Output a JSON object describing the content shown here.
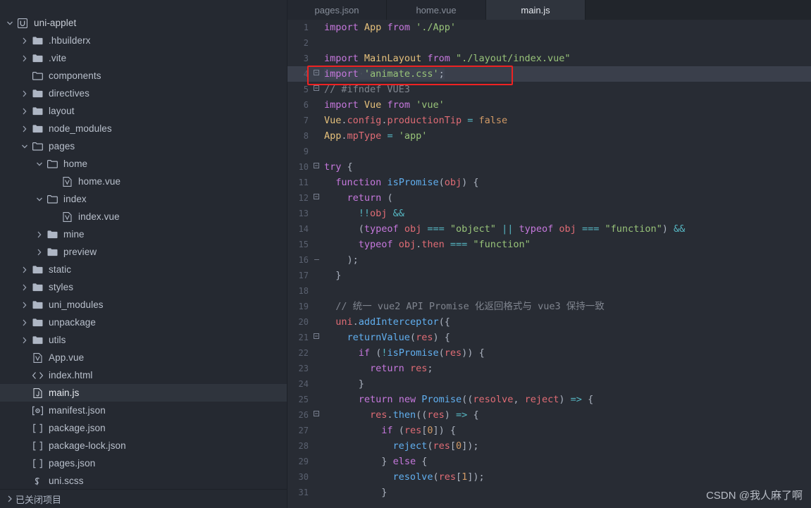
{
  "sidebar": {
    "tree": [
      {
        "label": "uni-applet",
        "depth": 0,
        "twisty": "down",
        "icon": "uni-logo-icon",
        "selected": false
      },
      {
        "label": ".hbuilderx",
        "depth": 1,
        "twisty": "right",
        "icon": "folder-icon",
        "selected": false
      },
      {
        "label": ".vite",
        "depth": 1,
        "twisty": "right",
        "icon": "folder-icon",
        "selected": false
      },
      {
        "label": "components",
        "depth": 1,
        "twisty": "none",
        "icon": "folder-open-icon",
        "selected": false
      },
      {
        "label": "directives",
        "depth": 1,
        "twisty": "right",
        "icon": "folder-icon",
        "selected": false
      },
      {
        "label": "layout",
        "depth": 1,
        "twisty": "right",
        "icon": "folder-icon",
        "selected": false
      },
      {
        "label": "node_modules",
        "depth": 1,
        "twisty": "right",
        "icon": "folder-icon",
        "selected": false
      },
      {
        "label": "pages",
        "depth": 1,
        "twisty": "down",
        "icon": "folder-open-icon",
        "selected": false
      },
      {
        "label": "home",
        "depth": 2,
        "twisty": "down",
        "icon": "folder-open-icon",
        "selected": false
      },
      {
        "label": "home.vue",
        "depth": 3,
        "twisty": "none",
        "icon": "vue-file-icon",
        "selected": false
      },
      {
        "label": "index",
        "depth": 2,
        "twisty": "down",
        "icon": "folder-open-icon",
        "selected": false
      },
      {
        "label": "index.vue",
        "depth": 3,
        "twisty": "none",
        "icon": "vue-file-icon",
        "selected": false
      },
      {
        "label": "mine",
        "depth": 2,
        "twisty": "right",
        "icon": "folder-icon",
        "selected": false
      },
      {
        "label": "preview",
        "depth": 2,
        "twisty": "right",
        "icon": "folder-icon",
        "selected": false
      },
      {
        "label": "static",
        "depth": 1,
        "twisty": "right",
        "icon": "folder-icon",
        "selected": false
      },
      {
        "label": "styles",
        "depth": 1,
        "twisty": "right",
        "icon": "folder-icon",
        "selected": false
      },
      {
        "label": "uni_modules",
        "depth": 1,
        "twisty": "right",
        "icon": "folder-icon",
        "selected": false
      },
      {
        "label": "unpackage",
        "depth": 1,
        "twisty": "right",
        "icon": "folder-icon",
        "selected": false
      },
      {
        "label": "utils",
        "depth": 1,
        "twisty": "right",
        "icon": "folder-icon",
        "selected": false
      },
      {
        "label": "App.vue",
        "depth": 1,
        "twisty": "none",
        "icon": "vue-file-icon",
        "selected": false
      },
      {
        "label": "index.html",
        "depth": 1,
        "twisty": "none",
        "icon": "html-file-icon",
        "selected": false
      },
      {
        "label": "main.js",
        "depth": 1,
        "twisty": "none",
        "icon": "js-file-icon",
        "selected": true
      },
      {
        "label": "manifest.json",
        "depth": 1,
        "twisty": "none",
        "icon": "manifest-file-icon",
        "selected": false
      },
      {
        "label": "package.json",
        "depth": 1,
        "twisty": "none",
        "icon": "json-file-icon",
        "selected": false
      },
      {
        "label": "package-lock.json",
        "depth": 1,
        "twisty": "none",
        "icon": "json-file-icon",
        "selected": false
      },
      {
        "label": "pages.json",
        "depth": 1,
        "twisty": "none",
        "icon": "json-file-icon",
        "selected": false
      },
      {
        "label": "uni.scss",
        "depth": 1,
        "twisty": "none",
        "icon": "scss-file-icon",
        "selected": false
      }
    ],
    "closed_projects": {
      "label": "已关闭项目",
      "twisty": "right"
    }
  },
  "tabs": [
    {
      "label": "pages.json",
      "active": false
    },
    {
      "label": "home.vue",
      "active": false
    },
    {
      "label": "main.js",
      "active": true
    }
  ],
  "editor": {
    "file": "main.js",
    "lines": [
      {
        "n": 1,
        "fold": "",
        "text": "import App from './App'"
      },
      {
        "n": 2,
        "fold": "",
        "text": ""
      },
      {
        "n": 3,
        "fold": "",
        "text": "import MainLayout from \"./layout/index.vue\""
      },
      {
        "n": 4,
        "fold": "box",
        "text": "import 'animate.css';"
      },
      {
        "n": 5,
        "fold": "box",
        "text": "// #ifndef VUE3"
      },
      {
        "n": 6,
        "fold": "",
        "text": "import Vue from 'vue'"
      },
      {
        "n": 7,
        "fold": "",
        "text": "Vue.config.productionTip = false"
      },
      {
        "n": 8,
        "fold": "",
        "text": "App.mpType = 'app'"
      },
      {
        "n": 9,
        "fold": "",
        "text": ""
      },
      {
        "n": 10,
        "fold": "box",
        "text": "try {"
      },
      {
        "n": 11,
        "fold": "",
        "text": "  function isPromise(obj) {"
      },
      {
        "n": 12,
        "fold": "box",
        "text": "    return ("
      },
      {
        "n": 13,
        "fold": "",
        "text": "      !!obj &&"
      },
      {
        "n": 14,
        "fold": "",
        "text": "      (typeof obj === \"object\" || typeof obj === \"function\") &&"
      },
      {
        "n": 15,
        "fold": "",
        "text": "      typeof obj.then === \"function\""
      },
      {
        "n": 16,
        "fold": "dash",
        "text": "    );"
      },
      {
        "n": 17,
        "fold": "",
        "text": "  }"
      },
      {
        "n": 18,
        "fold": "",
        "text": ""
      },
      {
        "n": 19,
        "fold": "",
        "text": "  // 统一 vue2 API Promise 化返回格式与 vue3 保持一致"
      },
      {
        "n": 20,
        "fold": "",
        "text": "  uni.addInterceptor({"
      },
      {
        "n": 21,
        "fold": "box",
        "text": "    returnValue(res) {"
      },
      {
        "n": 22,
        "fold": "",
        "text": "      if (!isPromise(res)) {"
      },
      {
        "n": 23,
        "fold": "",
        "text": "        return res;"
      },
      {
        "n": 24,
        "fold": "",
        "text": "      }"
      },
      {
        "n": 25,
        "fold": "",
        "text": "      return new Promise((resolve, reject) => {"
      },
      {
        "n": 26,
        "fold": "box",
        "text": "        res.then((res) => {"
      },
      {
        "n": 27,
        "fold": "",
        "text": "          if (res[0]) {"
      },
      {
        "n": 28,
        "fold": "",
        "text": "            reject(res[0]);"
      },
      {
        "n": 29,
        "fold": "",
        "text": "          } else {"
      },
      {
        "n": 30,
        "fold": "",
        "text": "            resolve(res[1]);"
      },
      {
        "n": 31,
        "fold": "",
        "text": "          }"
      }
    ],
    "highlight": {
      "line": 4,
      "annotation_color": "#ee2222"
    }
  },
  "watermark": {
    "text": "CSDN @我人麻了啊"
  },
  "colors": {
    "sidebar_bg": "#252931",
    "editor_bg": "#282c34",
    "tab_active_bg": "#2f343d",
    "accent_red": "#ee2222"
  }
}
